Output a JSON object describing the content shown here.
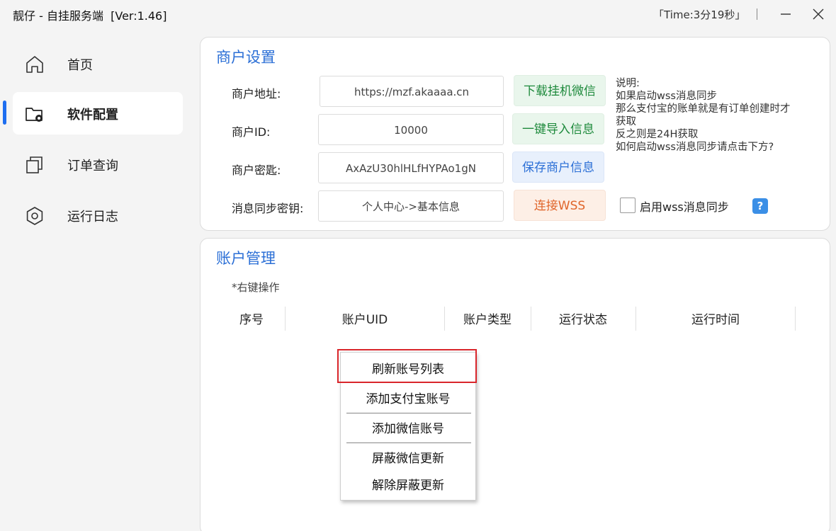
{
  "window": {
    "title": "靓仔 - 自挂服务端  [Ver:1.46]",
    "timer": "「Time:3分19秒」",
    "minimize_icon": "minimize-icon",
    "close_icon": "close-icon"
  },
  "sidebar": {
    "items": [
      {
        "label": "首页",
        "icon": "home-icon",
        "active": false
      },
      {
        "label": "软件配置",
        "icon": "folder-settings-icon",
        "active": true
      },
      {
        "label": "订单查询",
        "icon": "copy-icon",
        "active": false
      },
      {
        "label": "运行日志",
        "icon": "settings-icon",
        "active": false
      }
    ]
  },
  "merchant": {
    "title": "商户设置",
    "address_label": "商户地址:",
    "address_value": "https://mzf.akaaaa.cn",
    "id_label": "商户ID:",
    "id_value": "10000",
    "key_label": "商户密匙:",
    "key_value": "AxAzU30hlHLfHYPAo1gN",
    "sync_key_label": "消息同步密钥:",
    "sync_key_value": "个人中心->基本信息",
    "btn_download": "下载挂机微信",
    "btn_import": "一键导入信息",
    "btn_save": "保存商户信息",
    "btn_connect": "连接WSS",
    "notes": [
      "说明:",
      "如果启动wss消息同步",
      "那么支付宝的账单就是有订单创建时才",
      "获取",
      "反之则是24H获取",
      "如何启动wss消息同步请点击下方?"
    ],
    "enable_sync_label": "启用wss消息同步",
    "enable_sync_checked": false,
    "help_icon": "?"
  },
  "accounts": {
    "title": "账户管理",
    "hint": "*右键操作",
    "columns": [
      "序号",
      "账户UID",
      "账户类型",
      "运行状态",
      "运行时间"
    ]
  },
  "context_menu": {
    "items": [
      "刷新账号列表",
      "添加支付宝账号",
      "添加微信账号",
      "屏蔽微信更新",
      "解除屏蔽更新"
    ]
  },
  "colors": {
    "accent": "#2b6fd6",
    "active_bar": "#1e6ef0",
    "highlight": "#d9262b"
  }
}
